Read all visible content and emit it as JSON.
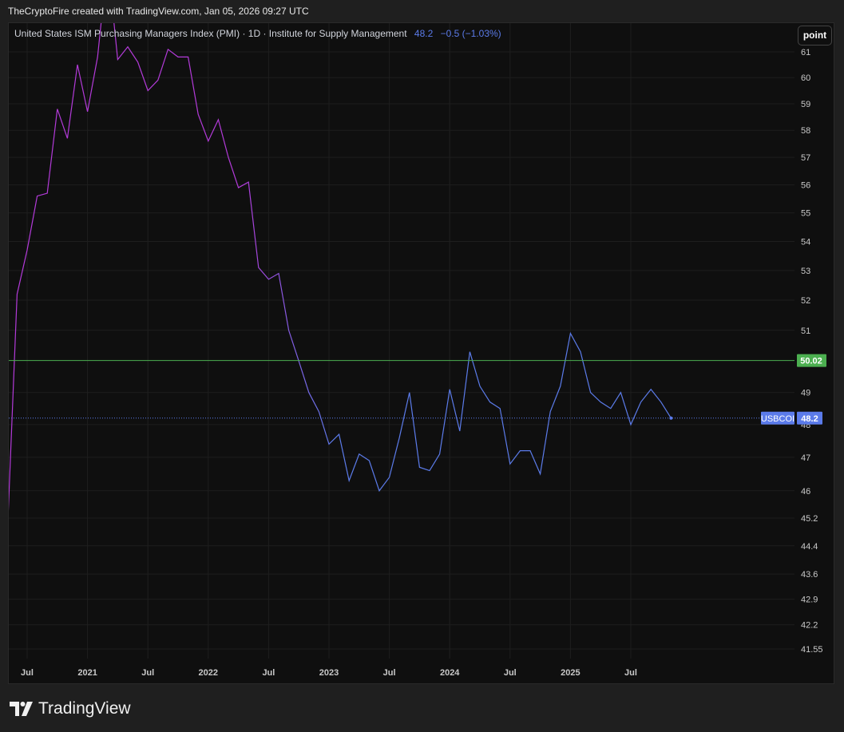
{
  "header": {
    "credit": "TheCryptoFire created with TradingView.com, Jan 05, 2026 09:27 UTC"
  },
  "legend": {
    "title": "United States ISM Purchasing Managers Index (PMI) · 1D · Institute for Supply Management",
    "value": "48.2",
    "change": "−0.5 (−1.03%)"
  },
  "toolbar": {
    "point_label": "point"
  },
  "footer": {
    "brand": "TradingView"
  },
  "colors": {
    "line_start": "#b33ad9",
    "line_end": "#5b7bea",
    "threshold": "#4caf50",
    "last": "#5b7bea"
  },
  "chart_data": {
    "type": "line",
    "title": "United States ISM Purchasing Managers Index (PMI)",
    "scale": "log",
    "ylim": [
      41.3,
      61.6
    ],
    "yticks": [
      "61",
      "60",
      "59",
      "58",
      "57",
      "56",
      "55",
      "54",
      "53",
      "52",
      "51",
      "49",
      "48",
      "47",
      "46",
      "45.2",
      "44.4",
      "43.6",
      "42.9",
      "42.2",
      "41.55"
    ],
    "xticks": [
      {
        "label": "Jul",
        "date": "2020-07"
      },
      {
        "label": "2021",
        "date": "2021-01"
      },
      {
        "label": "Jul",
        "date": "2021-07"
      },
      {
        "label": "2022",
        "date": "2022-01"
      },
      {
        "label": "Jul",
        "date": "2022-07"
      },
      {
        "label": "2023",
        "date": "2023-01"
      },
      {
        "label": "Jul",
        "date": "2023-07"
      },
      {
        "label": "2024",
        "date": "2024-01"
      },
      {
        "label": "Jul",
        "date": "2024-07"
      },
      {
        "label": "2025",
        "date": "2025-01"
      },
      {
        "label": "Jul",
        "date": "2025-07"
      }
    ],
    "series": [
      {
        "name": "USBCOI",
        "start": "2020-05",
        "frequency": "monthly",
        "values": [
          44.5,
          52.2,
          53.7,
          55.6,
          55.7,
          58.8,
          57.7,
          60.5,
          58.7,
          60.8,
          64.7,
          60.7,
          61.2,
          60.6,
          59.5,
          59.9,
          61.1,
          60.8,
          60.8,
          58.6,
          57.6,
          58.4,
          57.0,
          55.9,
          56.1,
          53.1,
          52.7,
          52.9,
          51.0,
          50.0,
          49.0,
          48.4,
          47.4,
          47.7,
          46.3,
          47.1,
          46.9,
          46.0,
          46.4,
          47.6,
          49.0,
          46.7,
          46.6,
          47.1,
          49.1,
          47.8,
          50.3,
          49.2,
          48.7,
          48.5,
          46.8,
          47.2,
          47.2,
          46.5,
          48.4,
          49.2,
          50.9,
          50.3,
          49.0,
          48.7,
          48.5,
          49.0,
          48.0,
          48.7,
          49.1,
          48.7,
          48.2
        ]
      }
    ],
    "threshold": {
      "value": 50.02,
      "label": "50.02"
    },
    "last": {
      "symbol": "USBCOI",
      "value": 48.2,
      "label": "48.2"
    }
  }
}
